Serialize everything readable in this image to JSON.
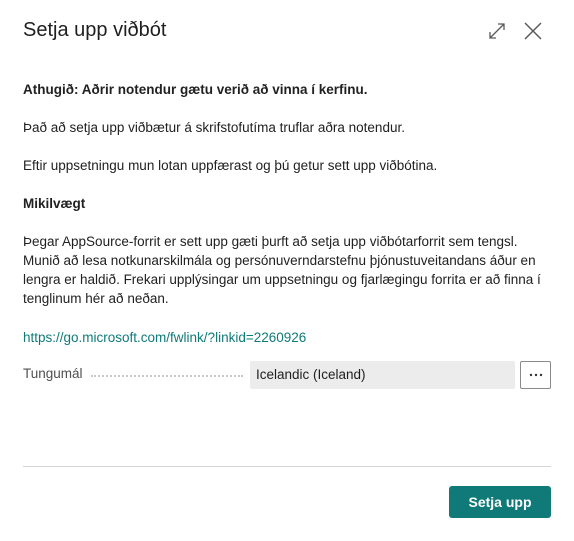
{
  "dialog": {
    "title": "Setja upp viðbót",
    "expand_icon": "expand-diagonal-icon",
    "close_icon": "close-icon"
  },
  "content": {
    "warning_heading": "Athugið: Aðrir notendur gætu verið að vinna í kerfinu.",
    "para_interrupt": "Það að setja upp viðbætur á skrifstofutíma truflar aðra notendur.",
    "para_after_install": "Eftir uppsetningu mun lotan uppfærast og þú getur sett upp viðbótina.",
    "important_heading": "Mikilvægt",
    "para_appsource": "Þegar AppSource-forrit er sett upp gæti þurft að setja upp viðbótarforrit sem tengsl. Munið að lesa notkunarskilmála og persónuverndarstefnu þjónustuveitandans áður en lengra er haldið. Frekari upplýsingar um uppsetningu og fjarlægingu forrita er að finna í tenglinum hér að neðan.",
    "link": "https://go.microsoft.com/fwlink/?linkid=2260926"
  },
  "language_field": {
    "label": "Tungumál",
    "value": "Icelandic (Iceland)",
    "more_icon": "ellipsis-icon"
  },
  "footer": {
    "primary_label": "Setja upp"
  },
  "colors": {
    "accent": "#0f7a78",
    "field_bg": "#ececec"
  }
}
